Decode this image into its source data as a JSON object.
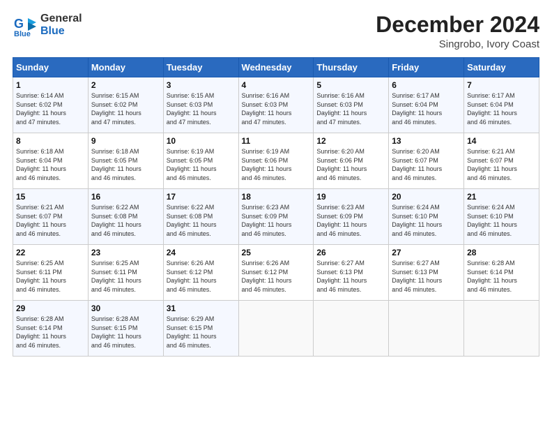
{
  "logo": {
    "line1": "General",
    "line2": "Blue"
  },
  "title": {
    "month_year": "December 2024",
    "location": "Singrobo, Ivory Coast"
  },
  "days_of_week": [
    "Sunday",
    "Monday",
    "Tuesday",
    "Wednesday",
    "Thursday",
    "Friday",
    "Saturday"
  ],
  "weeks": [
    [
      {
        "day": "1",
        "info": "Sunrise: 6:14 AM\nSunset: 6:02 PM\nDaylight: 11 hours\nand 47 minutes."
      },
      {
        "day": "2",
        "info": "Sunrise: 6:15 AM\nSunset: 6:02 PM\nDaylight: 11 hours\nand 47 minutes."
      },
      {
        "day": "3",
        "info": "Sunrise: 6:15 AM\nSunset: 6:03 PM\nDaylight: 11 hours\nand 47 minutes."
      },
      {
        "day": "4",
        "info": "Sunrise: 6:16 AM\nSunset: 6:03 PM\nDaylight: 11 hours\nand 47 minutes."
      },
      {
        "day": "5",
        "info": "Sunrise: 6:16 AM\nSunset: 6:03 PM\nDaylight: 11 hours\nand 47 minutes."
      },
      {
        "day": "6",
        "info": "Sunrise: 6:17 AM\nSunset: 6:04 PM\nDaylight: 11 hours\nand 46 minutes."
      },
      {
        "day": "7",
        "info": "Sunrise: 6:17 AM\nSunset: 6:04 PM\nDaylight: 11 hours\nand 46 minutes."
      }
    ],
    [
      {
        "day": "8",
        "info": "Sunrise: 6:18 AM\nSunset: 6:04 PM\nDaylight: 11 hours\nand 46 minutes."
      },
      {
        "day": "9",
        "info": "Sunrise: 6:18 AM\nSunset: 6:05 PM\nDaylight: 11 hours\nand 46 minutes."
      },
      {
        "day": "10",
        "info": "Sunrise: 6:19 AM\nSunset: 6:05 PM\nDaylight: 11 hours\nand 46 minutes."
      },
      {
        "day": "11",
        "info": "Sunrise: 6:19 AM\nSunset: 6:06 PM\nDaylight: 11 hours\nand 46 minutes."
      },
      {
        "day": "12",
        "info": "Sunrise: 6:20 AM\nSunset: 6:06 PM\nDaylight: 11 hours\nand 46 minutes."
      },
      {
        "day": "13",
        "info": "Sunrise: 6:20 AM\nSunset: 6:07 PM\nDaylight: 11 hours\nand 46 minutes."
      },
      {
        "day": "14",
        "info": "Sunrise: 6:21 AM\nSunset: 6:07 PM\nDaylight: 11 hours\nand 46 minutes."
      }
    ],
    [
      {
        "day": "15",
        "info": "Sunrise: 6:21 AM\nSunset: 6:07 PM\nDaylight: 11 hours\nand 46 minutes."
      },
      {
        "day": "16",
        "info": "Sunrise: 6:22 AM\nSunset: 6:08 PM\nDaylight: 11 hours\nand 46 minutes."
      },
      {
        "day": "17",
        "info": "Sunrise: 6:22 AM\nSunset: 6:08 PM\nDaylight: 11 hours\nand 46 minutes."
      },
      {
        "day": "18",
        "info": "Sunrise: 6:23 AM\nSunset: 6:09 PM\nDaylight: 11 hours\nand 46 minutes."
      },
      {
        "day": "19",
        "info": "Sunrise: 6:23 AM\nSunset: 6:09 PM\nDaylight: 11 hours\nand 46 minutes."
      },
      {
        "day": "20",
        "info": "Sunrise: 6:24 AM\nSunset: 6:10 PM\nDaylight: 11 hours\nand 46 minutes."
      },
      {
        "day": "21",
        "info": "Sunrise: 6:24 AM\nSunset: 6:10 PM\nDaylight: 11 hours\nand 46 minutes."
      }
    ],
    [
      {
        "day": "22",
        "info": "Sunrise: 6:25 AM\nSunset: 6:11 PM\nDaylight: 11 hours\nand 46 minutes."
      },
      {
        "day": "23",
        "info": "Sunrise: 6:25 AM\nSunset: 6:11 PM\nDaylight: 11 hours\nand 46 minutes."
      },
      {
        "day": "24",
        "info": "Sunrise: 6:26 AM\nSunset: 6:12 PM\nDaylight: 11 hours\nand 46 minutes."
      },
      {
        "day": "25",
        "info": "Sunrise: 6:26 AM\nSunset: 6:12 PM\nDaylight: 11 hours\nand 46 minutes."
      },
      {
        "day": "26",
        "info": "Sunrise: 6:27 AM\nSunset: 6:13 PM\nDaylight: 11 hours\nand 46 minutes."
      },
      {
        "day": "27",
        "info": "Sunrise: 6:27 AM\nSunset: 6:13 PM\nDaylight: 11 hours\nand 46 minutes."
      },
      {
        "day": "28",
        "info": "Sunrise: 6:28 AM\nSunset: 6:14 PM\nDaylight: 11 hours\nand 46 minutes."
      }
    ],
    [
      {
        "day": "29",
        "info": "Sunrise: 6:28 AM\nSunset: 6:14 PM\nDaylight: 11 hours\nand 46 minutes."
      },
      {
        "day": "30",
        "info": "Sunrise: 6:28 AM\nSunset: 6:15 PM\nDaylight: 11 hours\nand 46 minutes."
      },
      {
        "day": "31",
        "info": "Sunrise: 6:29 AM\nSunset: 6:15 PM\nDaylight: 11 hours\nand 46 minutes."
      },
      {
        "day": "",
        "info": ""
      },
      {
        "day": "",
        "info": ""
      },
      {
        "day": "",
        "info": ""
      },
      {
        "day": "",
        "info": ""
      }
    ]
  ]
}
